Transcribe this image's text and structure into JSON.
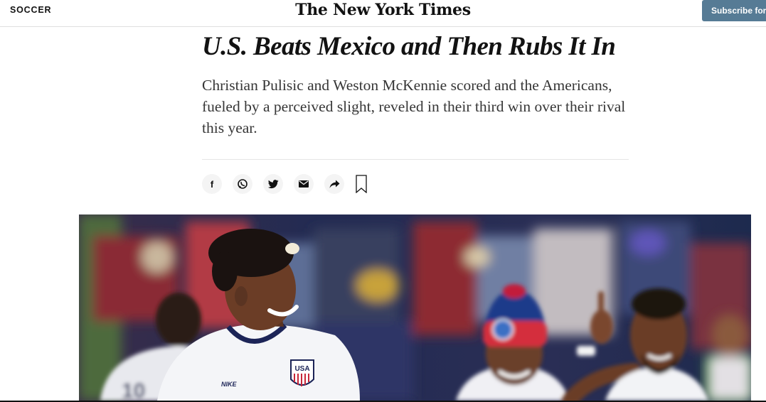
{
  "header": {
    "section": "SOCCER",
    "logo": "The New York Times",
    "subscribe_label": "Subscribe for"
  },
  "article": {
    "headline": "U.S. Beats Mexico and Then Rubs It In",
    "summary": "Christian Pulisic and Weston McKennie scored and the Americans, fueled by a perceived slight, reveled in their third win over their rival this year."
  },
  "share": {
    "icons": [
      "facebook-icon",
      "whatsapp-icon",
      "twitter-icon",
      "email-icon",
      "share-icon",
      "bookmark-icon"
    ]
  },
  "photo": {
    "jersey_texts": [
      "USA",
      "NIKE"
    ]
  },
  "colors": {
    "subscribe_bg": "#567b95",
    "text_primary": "#121212",
    "text_summary": "#363636"
  }
}
